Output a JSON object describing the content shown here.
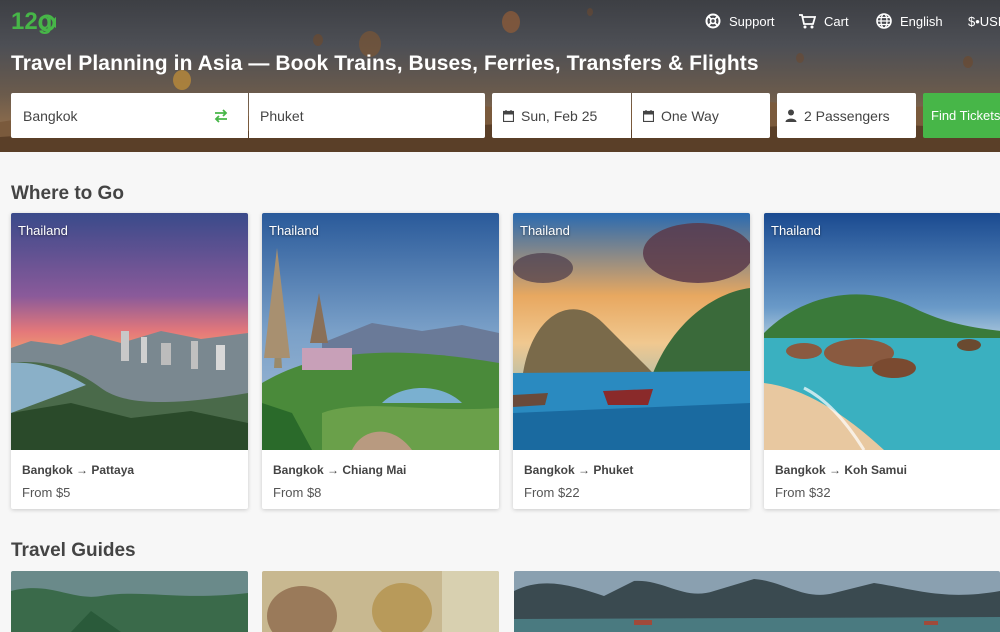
{
  "header": {
    "logo_text": "12go",
    "nav": {
      "support": "Support",
      "cart": "Cart",
      "language": "English",
      "currency": "$•USD"
    },
    "title": "Travel Planning in Asia — Book Trains, Buses, Ferries, Transfers & Flights"
  },
  "search": {
    "from": "Bangkok",
    "to": "Phuket",
    "date": "Sun, Feb 25",
    "trip_type": "One Way",
    "passengers": "2 Passengers",
    "find_button": "Find Tickets"
  },
  "where_to_go": {
    "title": "Where to Go",
    "cards": [
      {
        "country": "Thailand",
        "route": "Bangkok → Pattaya",
        "price": "From $5"
      },
      {
        "country": "Thailand",
        "route": "Bangkok → Chiang Mai",
        "price": "From $8"
      },
      {
        "country": "Thailand",
        "route": "Bangkok → Phuket",
        "price": "From $22"
      },
      {
        "country": "Thailand",
        "route": "Bangkok → Koh Samui",
        "price": "From $32"
      }
    ]
  },
  "travel_guides": {
    "title": "Travel Guides"
  },
  "colors": {
    "accent": "#47b648",
    "hero_overlay": "#4d4f55"
  }
}
